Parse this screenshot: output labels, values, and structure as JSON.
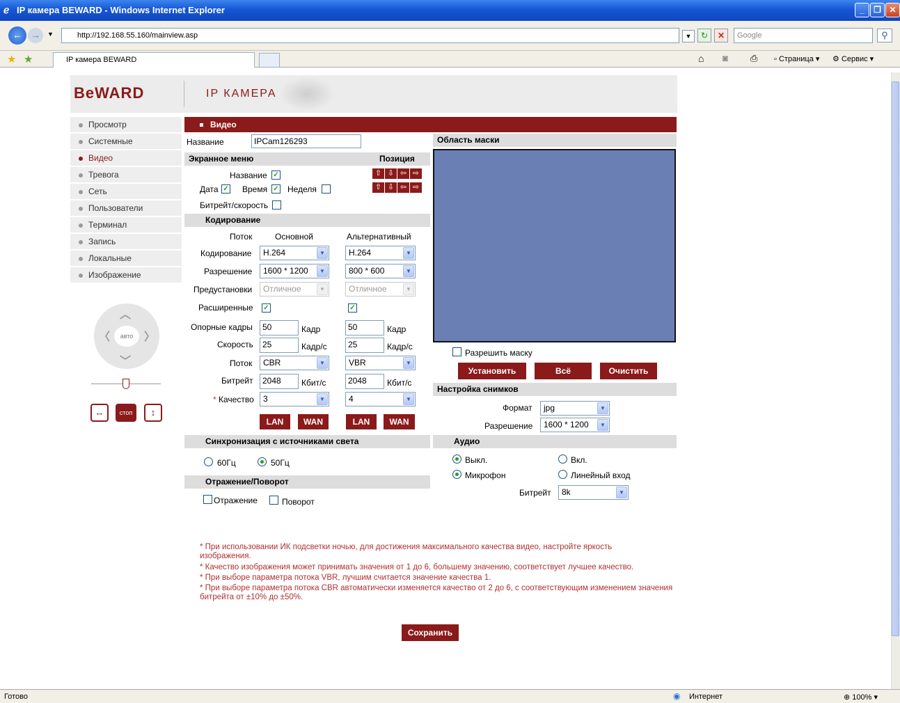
{
  "browser": {
    "window_title": "IP камера BEWARD - Windows Internet Explorer",
    "url": "http://192.168.55.160/mainview.asp",
    "search_placeholder": "Google",
    "tab_title": "IP камера BEWARD",
    "toolbar_page": "Страница",
    "toolbar_service": "Сервис",
    "status_text": "Готово",
    "zone": "Интернет",
    "zoom": "100%"
  },
  "header": {
    "logo": "BeWARD",
    "subtitle": "IP КАМЕРА"
  },
  "menu": [
    {
      "label": "Просмотр"
    },
    {
      "label": "Системные"
    },
    {
      "label": "Видео"
    },
    {
      "label": "Тревога"
    },
    {
      "label": "Сеть"
    },
    {
      "label": "Пользователи"
    },
    {
      "label": "Терминал"
    },
    {
      "label": "Запись"
    },
    {
      "label": "Локальные"
    },
    {
      "label": "Изображение"
    }
  ],
  "ptz": {
    "center": "авто",
    "stop": "стоп"
  },
  "video": {
    "section_title": "Видео",
    "name_label": "Название",
    "name_value": "IPCam126293",
    "osd": {
      "title": "Экранное меню",
      "position": "Позиция",
      "name": "Название",
      "date": "Дата",
      "time": "Время",
      "week": "Неделя",
      "bitrate_speed": "Битрейт/скорость"
    },
    "encoding": {
      "title": "Кодирование",
      "col_stream": "Поток",
      "col_main": "Основной",
      "col_alt": "Альтернативный",
      "codec_label": "Кодирование",
      "codec_main": "H.264",
      "codec_alt": "H.264",
      "res_label": "Разрешение",
      "res_main": "1600 * 1200",
      "res_alt": "800 * 600",
      "preset_label": "Предустановки",
      "preset_main": "Отличное",
      "preset_alt": "Отличное",
      "advanced_label": "Расширенные",
      "keyframe_label": "Опорные кадры",
      "keyframe_main": "50",
      "keyframe_alt": "50",
      "keyframe_unit": "Кадр",
      "fps_label": "Скорость",
      "fps_main": "25",
      "fps_alt": "25",
      "fps_unit": "Кадр/с",
      "stream_label": "Поток",
      "stream_main": "CBR",
      "stream_alt": "VBR",
      "bitrate_label": "Битрейт",
      "bitrate_main": "2048",
      "bitrate_alt": "2048",
      "bitrate_unit": "Кбит/с",
      "quality_star": "*",
      "quality_label": "Качество",
      "quality_main": "3",
      "quality_alt": "4",
      "lan": "LAN",
      "wan": "WAN"
    },
    "sync": {
      "title": "Синхронизация с источниками света",
      "hz60": "60Гц",
      "hz50": "50Гц"
    },
    "flip": {
      "title": "Отражение/Поворот",
      "mirror": "Отражение",
      "rotate": "Поворот"
    }
  },
  "mask": {
    "title": "Область маски",
    "enable": "Разрешить маску",
    "set": "Установить",
    "all": "Всё",
    "clear": "Очистить"
  },
  "snapshot": {
    "title": "Настройка снимков",
    "format_label": "Формат",
    "format_value": "jpg",
    "res_label": "Разрешение",
    "res_value": "1600 * 1200"
  },
  "audio": {
    "title": "Аудио",
    "off": "Выкл.",
    "on": "Вкл.",
    "mic": "Микрофон",
    "line_in": "Линейный вход",
    "bitrate_label": "Битрейт",
    "bitrate_value": "8k"
  },
  "notes": [
    "* При использовании ИК подсветки ночью, для достижения максимального качества видео, настройте яркость изображения.",
    "* Качество изображения может принимать значения от 1 до 6, большему значению, соответствует лучшее качество.",
    "* При выборе параметра потока VBR, лучшим считается значение качества 1.",
    "* При выборе параметра потока CBR автоматически изменяется качество от 2 до 6, с соответствующим изменением значения битрейта от ±10% до ±50%."
  ],
  "save": "Сохранить"
}
